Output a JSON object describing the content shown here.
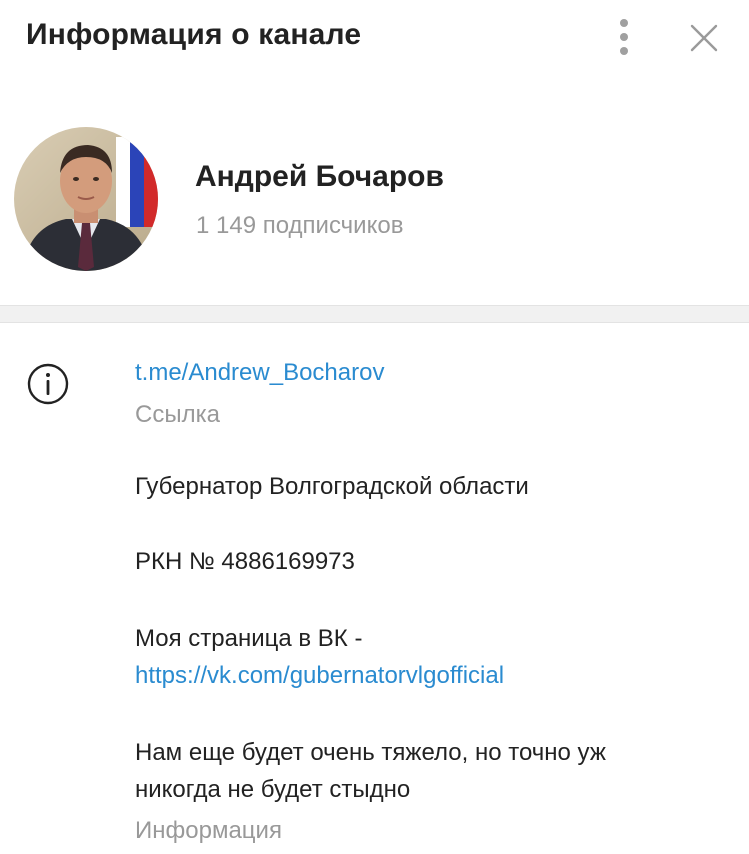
{
  "header": {
    "title": "Информация о канале",
    "menu_icon": "more-vertical-icon",
    "close_icon": "close-icon"
  },
  "profile": {
    "name": "Андрей Бочаров",
    "subscribers": "1 149 подписчиков"
  },
  "info": {
    "icon": "info-icon",
    "link": "t.me/Andrew_Bocharov",
    "link_label": "Ссылка",
    "description": {
      "line1": "Губернатор Волгоградской области",
      "line2": "РКН № 4886169973",
      "line3": "Моя страница в ВК -",
      "vk_link": "https://vk.com/gubernatorvlgofficial",
      "line4": "Нам еще будет очень тяжело, но точно уж",
      "line5": "никогда не будет стыдно"
    },
    "description_label": "Информация"
  },
  "colors": {
    "link": "#2a8bd0",
    "muted": "#999999",
    "text": "#222222",
    "divider": "#f1f1f1"
  }
}
